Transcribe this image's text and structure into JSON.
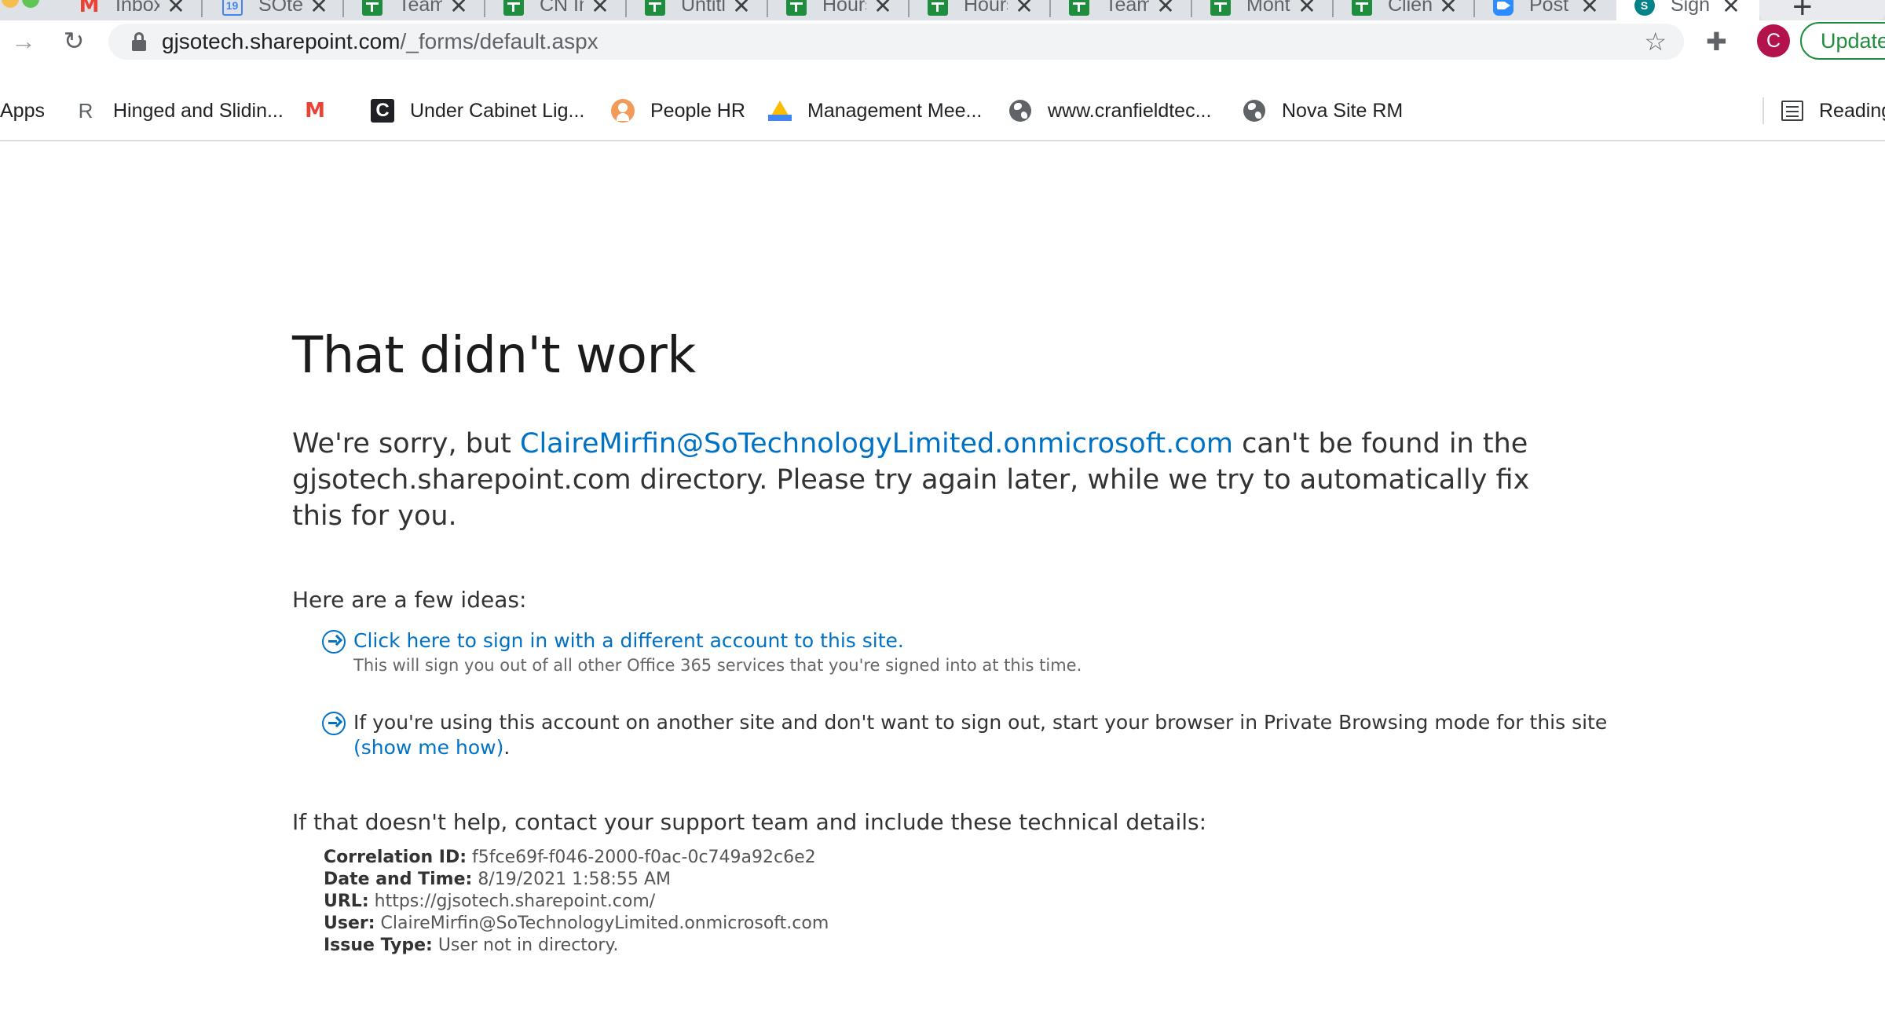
{
  "browser": {
    "tabs": [
      {
        "title": "Inbox",
        "icon": "gmail-icon"
      },
      {
        "title": "SOtech",
        "icon": "calendar-icon"
      },
      {
        "title": "Team",
        "icon": "sheets-icon"
      },
      {
        "title": "CN In",
        "icon": "sheets-icon"
      },
      {
        "title": "Untitled",
        "icon": "sheets-icon"
      },
      {
        "title": "Hours",
        "icon": "sheets-icon"
      },
      {
        "title": "Hours",
        "icon": "sheets-icon"
      },
      {
        "title": "Team",
        "icon": "sheets-icon"
      },
      {
        "title": "Month",
        "icon": "sheets-icon"
      },
      {
        "title": "Client",
        "icon": "sheets-icon"
      },
      {
        "title": "Post",
        "icon": "zoom-icon"
      },
      {
        "title": "Sign",
        "icon": "sharepoint-icon",
        "active": true
      }
    ],
    "calendar_day": "19",
    "url_host": "gjsotech.sharepoint.com",
    "url_path": "/_forms/default.aspx",
    "avatar_letter": "C",
    "update_label": "Update",
    "bookmarks": {
      "apps": "Apps",
      "hinged": "Hinged and Slidin...",
      "under_cabinet": "Under Cabinet Lig...",
      "people_hr": "People HR",
      "management": "Management Mee...",
      "cranfield": "www.cranfieldtec...",
      "nova": "Nova Site RM",
      "reading": "Reading"
    },
    "bookmark_letters": {
      "r": "R",
      "m": "M",
      "c": "C"
    }
  },
  "page": {
    "heading": "That didn't work",
    "message_before": "We're sorry, but ",
    "message_email": "ClaireMirfin@SoTechnologyLimited.onmicrosoft.com",
    "message_after": " can't be found in the gjsotech.sharepoint.com directory. Please try again later, while we try to automatically fix this for you.",
    "ideas_label": "Here are a few ideas:",
    "idea1_link": "Click here to sign in with a different account to this site.",
    "idea1_sub": "This will sign you out of all other Office 365 services that you're signed into at this time.",
    "idea2_text": "If you're using this account on another site and don't want to sign out, start your browser in Private Browsing mode for this site ",
    "idea2_link": "(show me how)",
    "idea2_end": ".",
    "help_label": "If that doesn't help, contact your support team and include these technical details:",
    "details": {
      "correlation_label": "Correlation ID:",
      "correlation_value": "f5fce69f-f046-2000-f0ac-0c749a92c6e2",
      "datetime_label": "Date and Time:",
      "datetime_value": "8/19/2021 1:58:55 AM",
      "url_label": "URL:",
      "url_value": "https://gjsotech.sharepoint.com/",
      "user_label": "User:",
      "user_value": "ClaireMirfin@SoTechnologyLimited.onmicrosoft.com",
      "issue_label": "Issue Type:",
      "issue_value": "User not in directory."
    }
  },
  "colors": {
    "link": "#0072c6",
    "update_green": "#1e8e3e",
    "avatar": "#b3124d"
  }
}
